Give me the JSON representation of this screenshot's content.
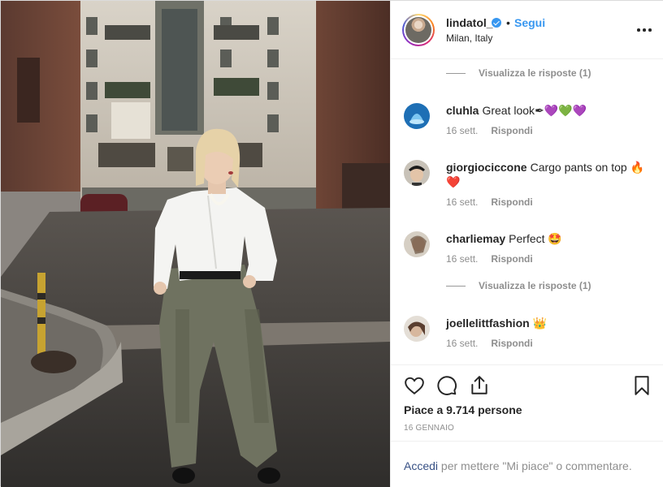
{
  "header": {
    "username": "lindatol_",
    "dot": "•",
    "follow_label": "Segui",
    "location": "Milan, Italy"
  },
  "comments": {
    "view_replies_1": "Visualizza le risposte (1)",
    "view_replies_2": "Visualizza le risposte (1)",
    "items": [
      {
        "user": "cluhla",
        "text": "Great look",
        "emoji": "✒💜💚💜",
        "time": "16 sett.",
        "reply": "Rispondi"
      },
      {
        "user": "giorgiociccone",
        "text": "Cargo pants on top",
        "emoji": "🔥❤️",
        "time": "16 sett.",
        "reply": "Rispondi"
      },
      {
        "user": "charliemay",
        "text": "Perfect",
        "emoji": "🤩",
        "time": "16 sett.",
        "reply": "Rispondi"
      },
      {
        "user": "joellelittfashion",
        "text": "",
        "emoji": "👑",
        "time": "16 sett.",
        "reply": "Rispondi"
      }
    ]
  },
  "actions": {
    "likes": "Piace a 9.714 persone",
    "date": "16 GENNAIO"
  },
  "login": {
    "link": "Accedi",
    "rest": " per mettere \"Mi piace\" o commentare."
  },
  "icons": {
    "like": "heart-icon",
    "comment": "comment-icon",
    "share": "share-icon",
    "save": "bookmark-icon",
    "more": "more-options-icon",
    "verified": "verified-badge-icon"
  },
  "colors": {
    "accent": "#3897f0",
    "muted": "#8e8e8e",
    "text": "#262626",
    "link": "#385185"
  }
}
